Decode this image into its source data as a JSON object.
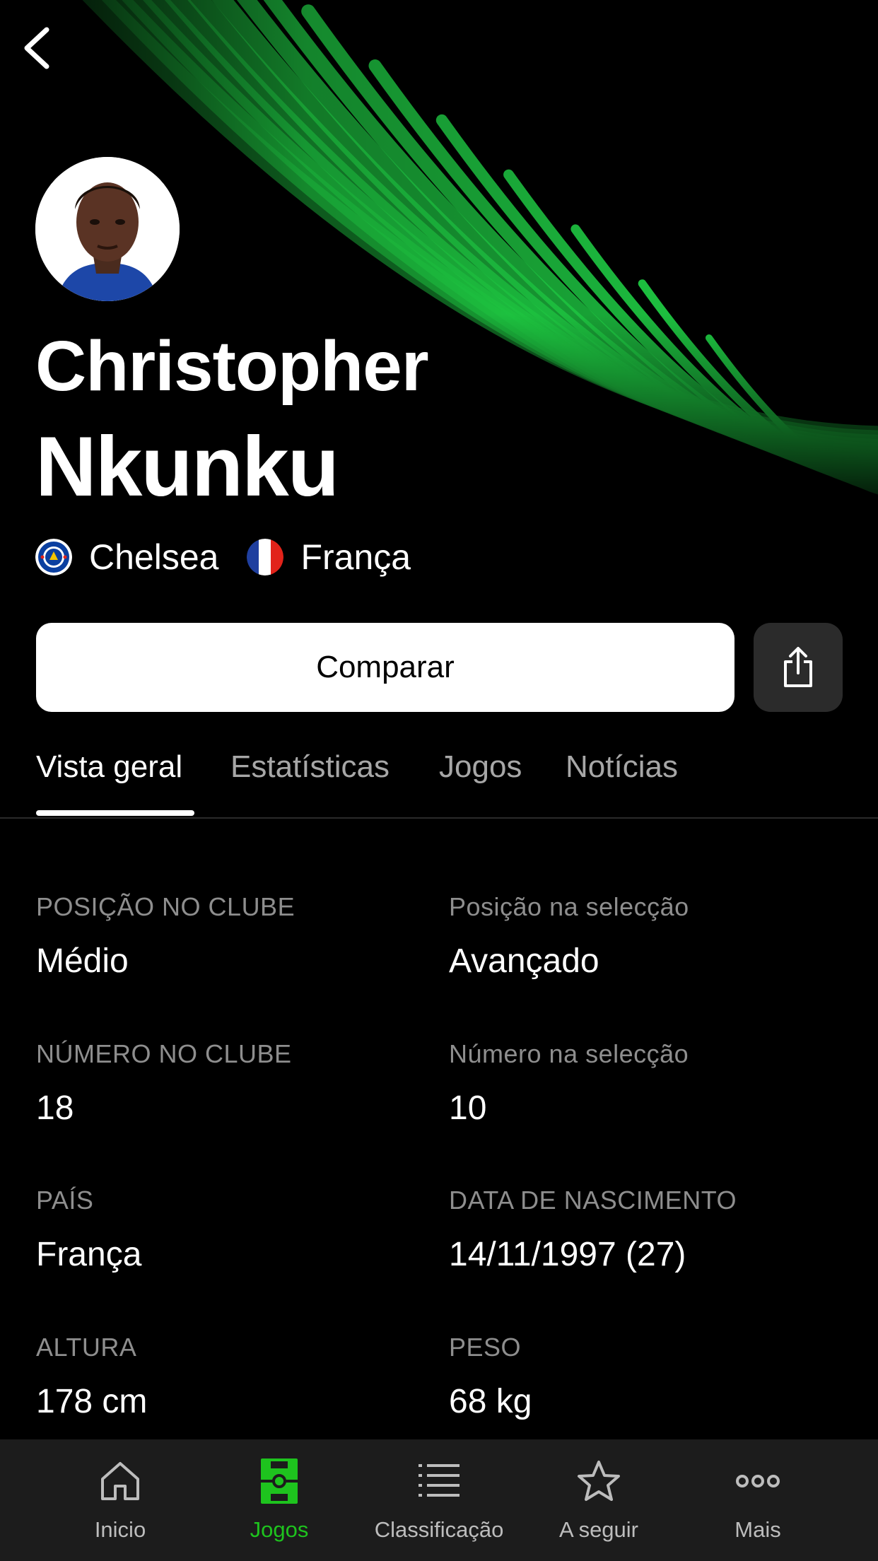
{
  "player": {
    "first_name": "Christopher",
    "last_name": "Nkunku",
    "club": "Chelsea",
    "nationality": "França"
  },
  "actions": {
    "compare_label": "Comparar"
  },
  "tabs": [
    {
      "label": "Vista geral"
    },
    {
      "label": "Estatísticas"
    },
    {
      "label": "Jogos"
    },
    {
      "label": "Notícias"
    }
  ],
  "info": {
    "club_position": {
      "label": "POSIÇÃO NO CLUBE",
      "value": "Médio"
    },
    "national_position": {
      "label": "Posição na selecção",
      "value": "Avançado"
    },
    "club_number": {
      "label": "NÚMERO NO CLUBE",
      "value": "18"
    },
    "national_number": {
      "label": "Número na selecção",
      "value": "10"
    },
    "country": {
      "label": "PAÍS",
      "value": "França"
    },
    "birth_date": {
      "label": "DATA DE NASCIMENTO",
      "value": "14/11/1997 (27)"
    },
    "height": {
      "label": "ALTURA",
      "value": "178 cm"
    },
    "weight": {
      "label": "PESO",
      "value": "68 kg"
    }
  },
  "bottom_nav": [
    {
      "label": "Inicio",
      "icon": "home-icon"
    },
    {
      "label": "Jogos",
      "icon": "pitch-icon",
      "active": true
    },
    {
      "label": "Classificação",
      "icon": "list-icon"
    },
    {
      "label": "A seguir",
      "icon": "star-icon"
    },
    {
      "label": "Mais",
      "icon": "more-icon"
    }
  ],
  "colors": {
    "accent_green": "#1ec31e",
    "background": "#000000",
    "nav_background": "#1c1c1c"
  }
}
